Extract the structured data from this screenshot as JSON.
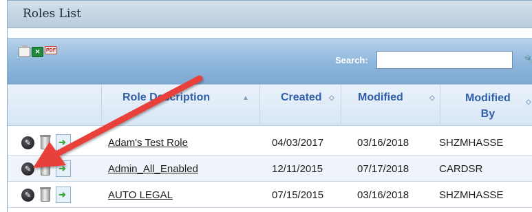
{
  "panel": {
    "title": "Roles List"
  },
  "toolbar": {
    "icons": [
      "clipboard-icon",
      "excel-export-icon",
      "pdf-export-icon"
    ],
    "search_label": "Search:",
    "search_value": "",
    "search_icon": "wrench-icon"
  },
  "table": {
    "columns": [
      {
        "label": "Role Description",
        "sort": "▲"
      },
      {
        "label": "Created",
        "sort": "◇"
      },
      {
        "label": "Modified",
        "sort": "◇"
      },
      {
        "label": "Modified\nBy",
        "sort": "◇"
      }
    ],
    "rows": [
      {
        "description": "Adam's Test Role",
        "created": "04/03/2017",
        "modified": "03/16/2018",
        "modified_by": "SHZMHASSE"
      },
      {
        "description": "Admin_All_Enabled",
        "created": "12/11/2015",
        "modified": "07/17/2018",
        "modified_by": "CARDSR"
      },
      {
        "description": "AUTO LEGAL",
        "created": "07/15/2015",
        "modified": "03/16/2018",
        "modified_by": "SHZMHASSE"
      }
    ],
    "row_actions": [
      "edit-icon",
      "delete-icon",
      "copy-icon"
    ]
  },
  "annotation": {
    "arrow_color": "#e8403a"
  },
  "colors": {
    "header_text": "#2f5fa8",
    "toolbar_blue": "#8db6dc"
  }
}
